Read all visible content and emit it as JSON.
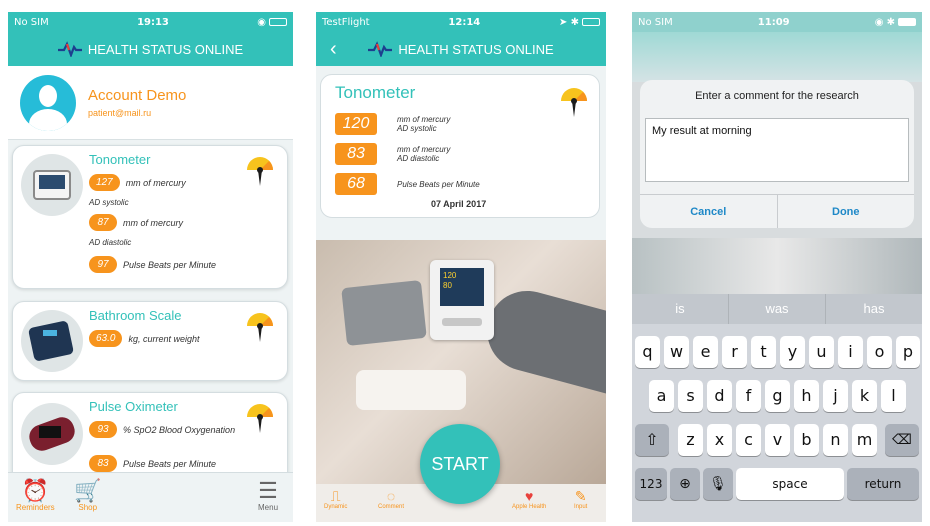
{
  "phone1": {
    "status": {
      "carrier": "No SIM",
      "time": "19:13"
    },
    "app_title": "HEALTH STATUS ONLINE",
    "account": {
      "name": "Account Demo",
      "email": "patient@mail.ru"
    },
    "cards": [
      {
        "title": "Tonometer",
        "m1_value": "127",
        "m1_label": "mm of mercury",
        "m1_sub": "AD systolic",
        "m2_value": "87",
        "m2_label": "mm of mercury",
        "m2_sub": "AD diastolic",
        "m3_value": "97",
        "m3_label": "Pulse Beats per Minute"
      },
      {
        "title": "Bathroom Scale",
        "m1_value": "63.0",
        "m1_label": "kg, current weight"
      },
      {
        "title": "Pulse Oximeter",
        "m1_value": "93",
        "m1_label": "% SpO2 Blood Oxygenation",
        "m2_value": "83",
        "m2_label": "Pulse Beats per Minute"
      }
    ],
    "tabs": {
      "reminders": "Reminders",
      "shop": "Shop",
      "menu": "Menu"
    }
  },
  "phone2": {
    "status": {
      "carrier": "TestFlight",
      "time": "12:14"
    },
    "app_title": "HEALTH STATUS ONLINE",
    "title": "Tonometer",
    "readings": [
      {
        "value": "120",
        "label1": "mm of mercury",
        "label2": "AD systolic"
      },
      {
        "value": "83",
        "label1": "mm of mercury",
        "label2": "AD diastolic"
      },
      {
        "value": "68",
        "label1": "Pulse Beats per Minute",
        "label2": ""
      }
    ],
    "date": "07 April 2017",
    "device_screen": {
      "top": "120",
      "bottom": "80"
    },
    "start": "START",
    "tabs": {
      "dynamic": "Dynamic",
      "comment": "Comment",
      "apple_health": "Apple Health",
      "input": "Input"
    }
  },
  "phone3": {
    "status": {
      "carrier": "No SIM",
      "time": "11:09"
    },
    "dialog": {
      "title": "Enter a comment for the research",
      "value": "My result at morning",
      "cancel": "Cancel",
      "done": "Done"
    },
    "suggestions": [
      "is",
      "was",
      "has"
    ],
    "row1": [
      "q",
      "w",
      "e",
      "r",
      "t",
      "y",
      "u",
      "i",
      "o",
      "p"
    ],
    "row2": [
      "a",
      "s",
      "d",
      "f",
      "g",
      "h",
      "j",
      "k",
      "l"
    ],
    "row3": [
      "z",
      "x",
      "c",
      "v",
      "b",
      "n",
      "m"
    ],
    "bottom": {
      "numbers": "123",
      "space": "space",
      "return": "return"
    }
  },
  "colors": {
    "teal": "#33c1b9",
    "orange": "#f7941d",
    "ios_blue": "#1e88c7"
  }
}
